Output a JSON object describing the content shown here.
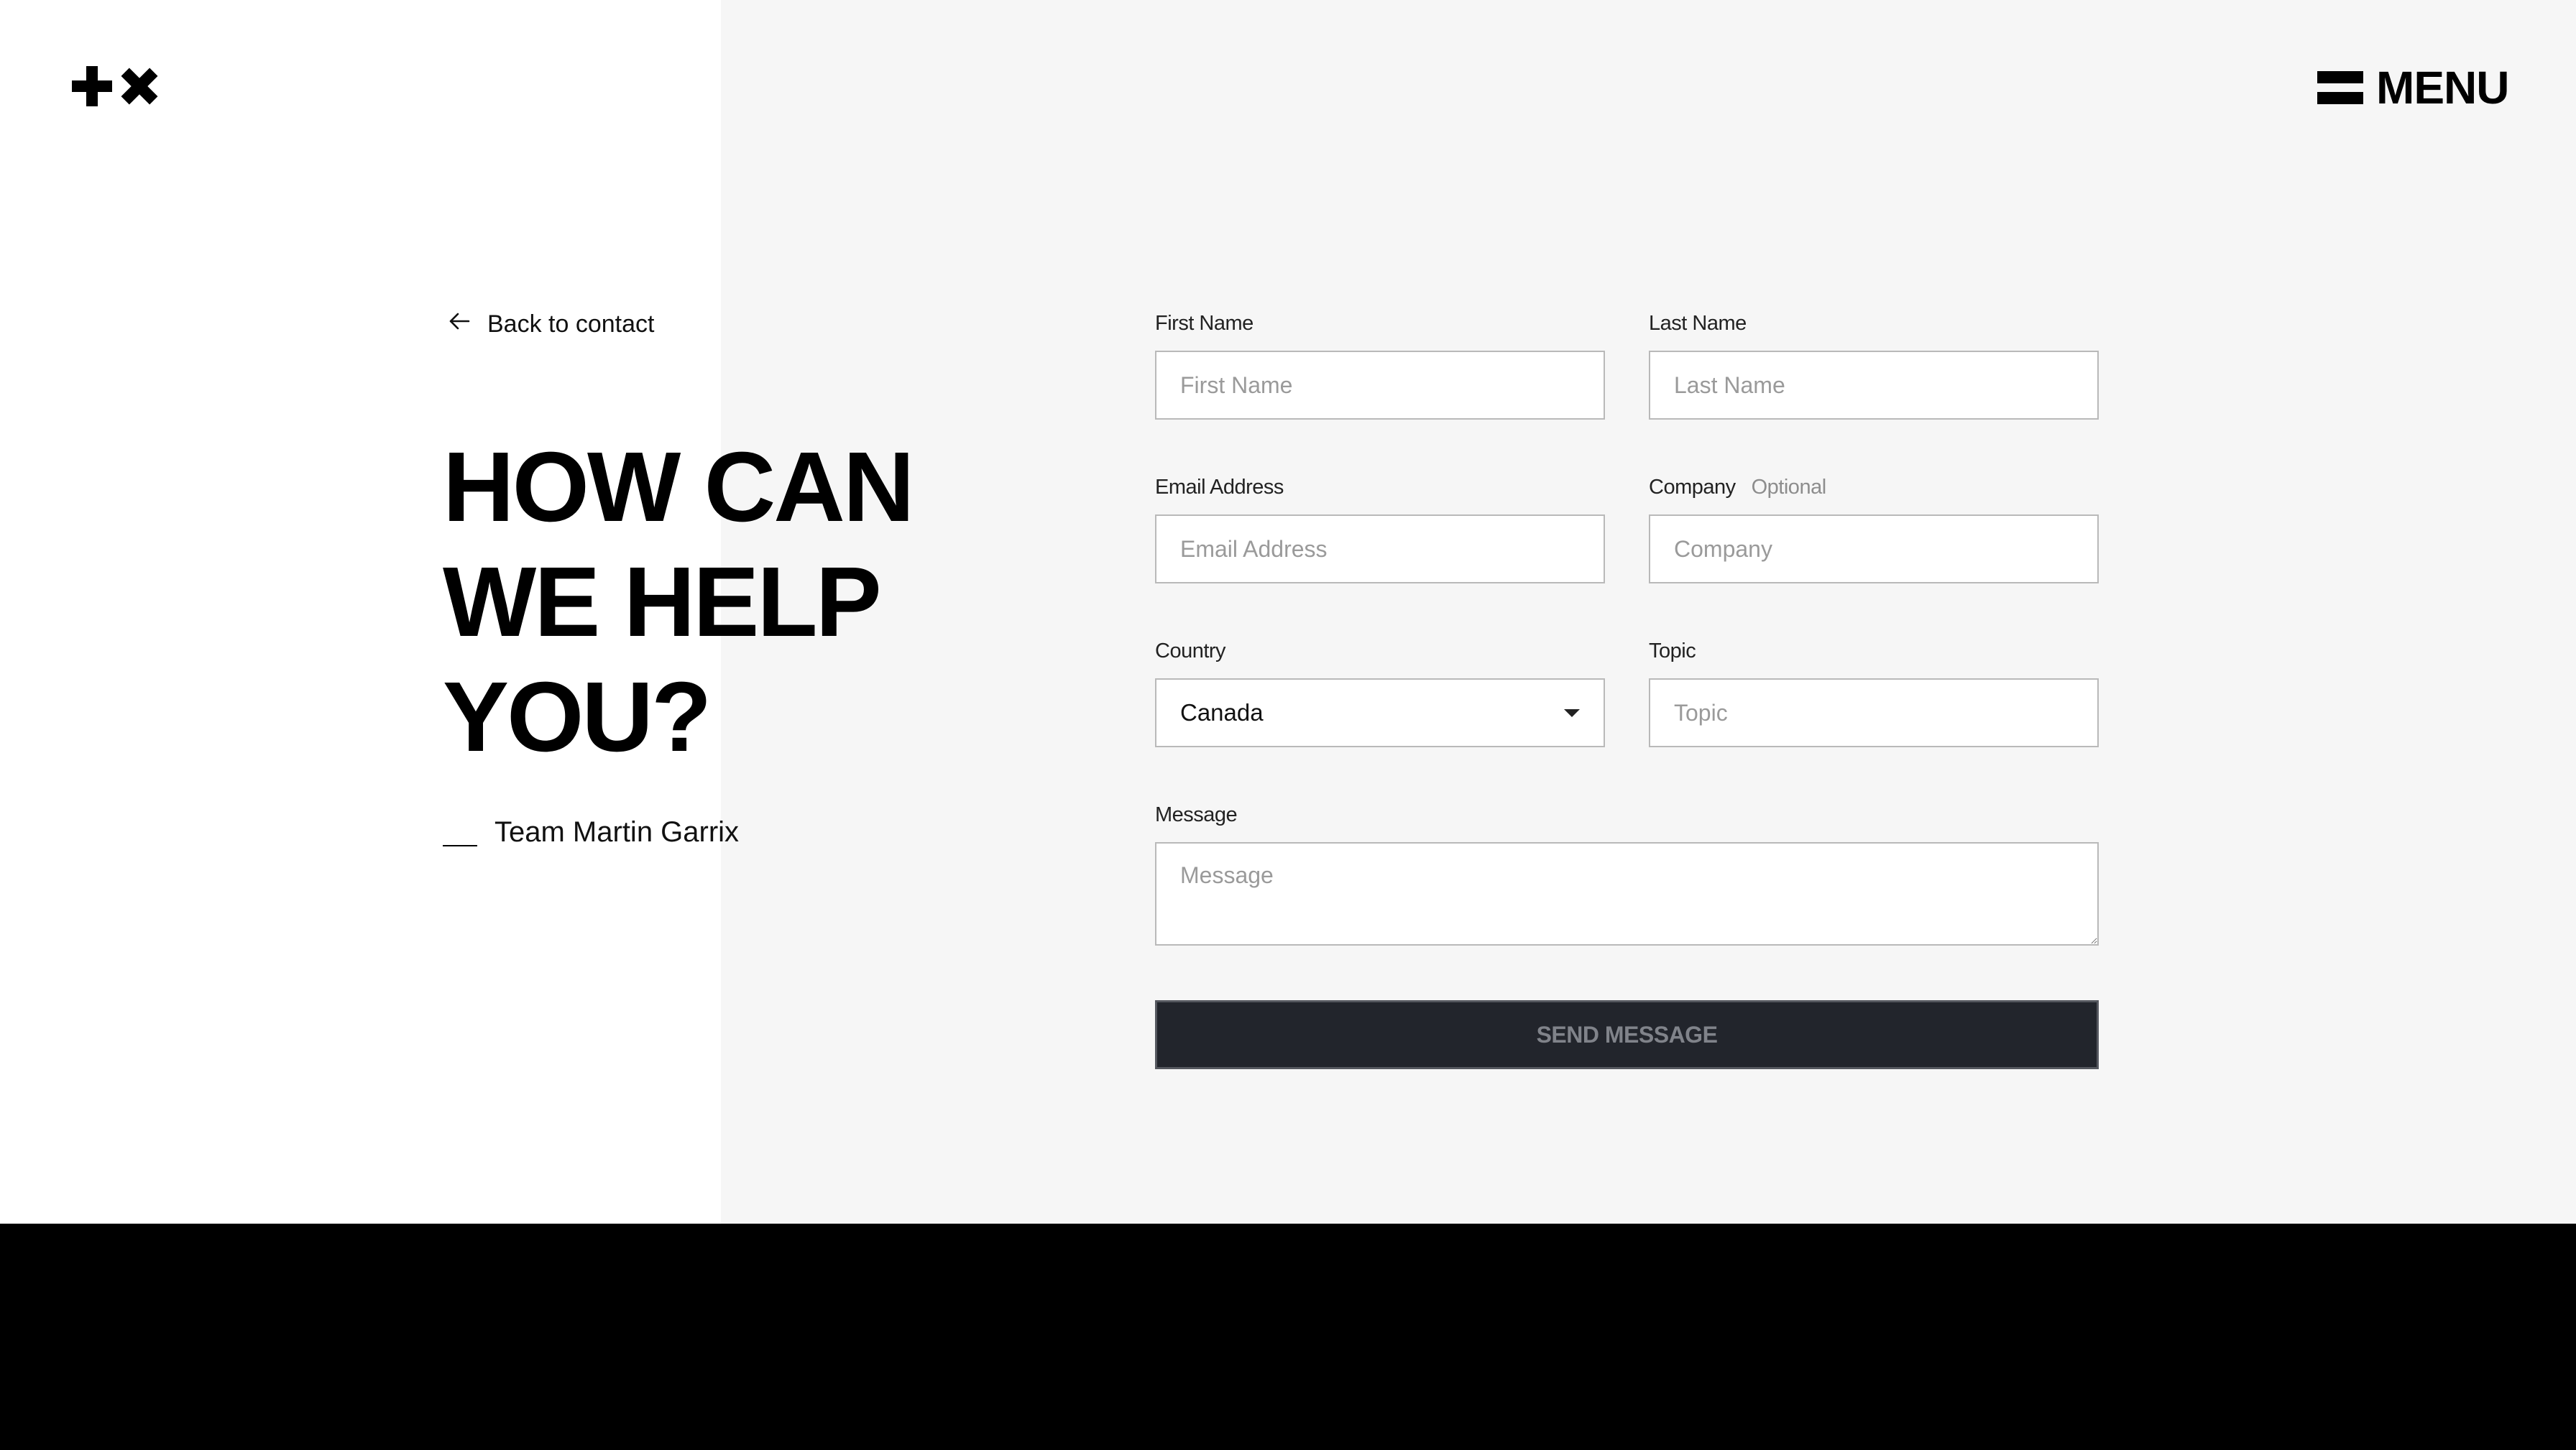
{
  "header": {
    "logo_icon": "plus-times-logo-icon",
    "menu_icon": "hamburger-icon",
    "menu_label": "MENU"
  },
  "intro": {
    "back_icon": "arrow-left-icon",
    "back_label": "Back to contact",
    "headline": [
      "HOW CAN",
      "WE HELP",
      "YOU?"
    ],
    "signature": "Team Martin Garrix"
  },
  "form": {
    "first_name": {
      "label": "First Name",
      "placeholder": "First Name",
      "value": ""
    },
    "last_name": {
      "label": "Last Name",
      "placeholder": "Last Name",
      "value": ""
    },
    "email": {
      "label": "Email Address",
      "placeholder": "Email Address",
      "value": ""
    },
    "company": {
      "label": "Company",
      "optional": "Optional",
      "placeholder": "Company",
      "value": ""
    },
    "country": {
      "label": "Country",
      "selected": "Canada",
      "icon": "caret-down-icon"
    },
    "topic": {
      "label": "Topic",
      "placeholder": "Topic",
      "value": ""
    },
    "message": {
      "label": "Message",
      "placeholder": "Message",
      "value": ""
    },
    "submit_label": "SEND MESSAGE"
  },
  "colors": {
    "page_bg": "#ffffff",
    "panel_bg": "#f6f6f6",
    "footer_bg": "#000000",
    "button_bg": "#22252c",
    "button_text": "#80838a",
    "input_border": "#b9b9b9"
  }
}
